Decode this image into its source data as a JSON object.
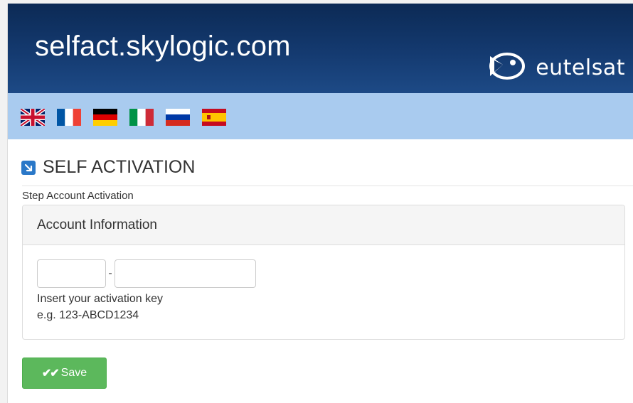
{
  "header": {
    "site_title": "selfact.skylogic.com",
    "brand_name": "eutelsat"
  },
  "languages": [
    {
      "code": "en",
      "flag": "uk-flag-icon"
    },
    {
      "code": "fr",
      "flag": "france-flag-icon"
    },
    {
      "code": "de",
      "flag": "germany-flag-icon"
    },
    {
      "code": "it",
      "flag": "italy-flag-icon"
    },
    {
      "code": "ru",
      "flag": "russia-flag-icon"
    },
    {
      "code": "es",
      "flag": "spain-flag-icon"
    }
  ],
  "page": {
    "title": "SELF ACTIVATION",
    "step_label": "Step Account Activation"
  },
  "panel": {
    "title": "Account Information",
    "separator": "-",
    "help_line1": "Insert your activation key",
    "help_line2": "e.g. 123-ABCD1234",
    "key_part1_value": "",
    "key_part2_value": ""
  },
  "actions": {
    "save_label": "Save"
  },
  "colors": {
    "banner": "#143a70",
    "lang_bar": "#a9cbef",
    "save_button": "#5cb85c",
    "heading_icon": "#2a78c8"
  }
}
